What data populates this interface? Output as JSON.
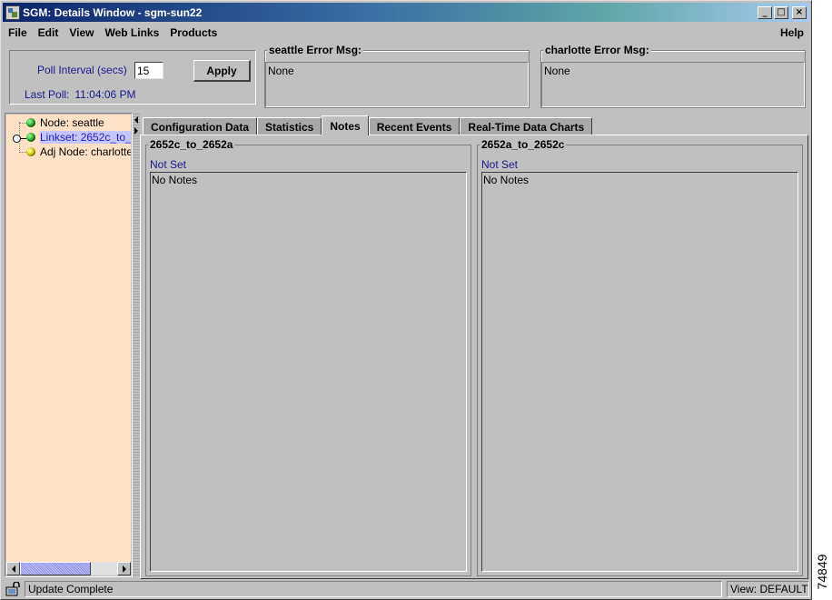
{
  "window": {
    "title": "SGM: Details Window - sgm-sun22",
    "buttons": {
      "minimize": "_",
      "maximize": "□",
      "close": "×"
    }
  },
  "menu": {
    "items": [
      "File",
      "Edit",
      "View",
      "Web Links",
      "Products"
    ],
    "help": "Help"
  },
  "poll": {
    "label": "Poll Interval (secs)",
    "value": "15",
    "apply_label": "Apply",
    "last_poll_label": "Last Poll:",
    "last_poll_time": "11:04:06 PM"
  },
  "errors": [
    {
      "title": "seattle  Error Msg:",
      "message": "None"
    },
    {
      "title": "charlotte  Error Msg:",
      "message": "None"
    }
  ],
  "tree": {
    "items": [
      {
        "label": "Node: seattle",
        "status": "green"
      },
      {
        "label": "Linkset: 2652c_to_",
        "status": "green",
        "selected": true
      },
      {
        "label": "Adj Node: charlotte",
        "status": "yellow"
      }
    ]
  },
  "tabs": {
    "items": [
      "Configuration Data",
      "Statistics",
      "Notes",
      "Recent Events",
      "Real-Time Data Charts"
    ],
    "active": "Notes"
  },
  "notes": [
    {
      "title": "2652c_to_2652a",
      "status": "Not Set",
      "text": "No Notes"
    },
    {
      "title": "2652a_to_2652c",
      "status": "Not Set",
      "text": "No Notes"
    }
  ],
  "status": {
    "message": "Update Complete",
    "view": "View: DEFAULT"
  },
  "figure_number": "74849",
  "colors": {
    "tree_bg": "#ffe2c6",
    "selection": "#c6c6ff",
    "label_blue": "#1a1a8c",
    "status_green": "#1aa01a",
    "status_yellow": "#d8c800"
  }
}
